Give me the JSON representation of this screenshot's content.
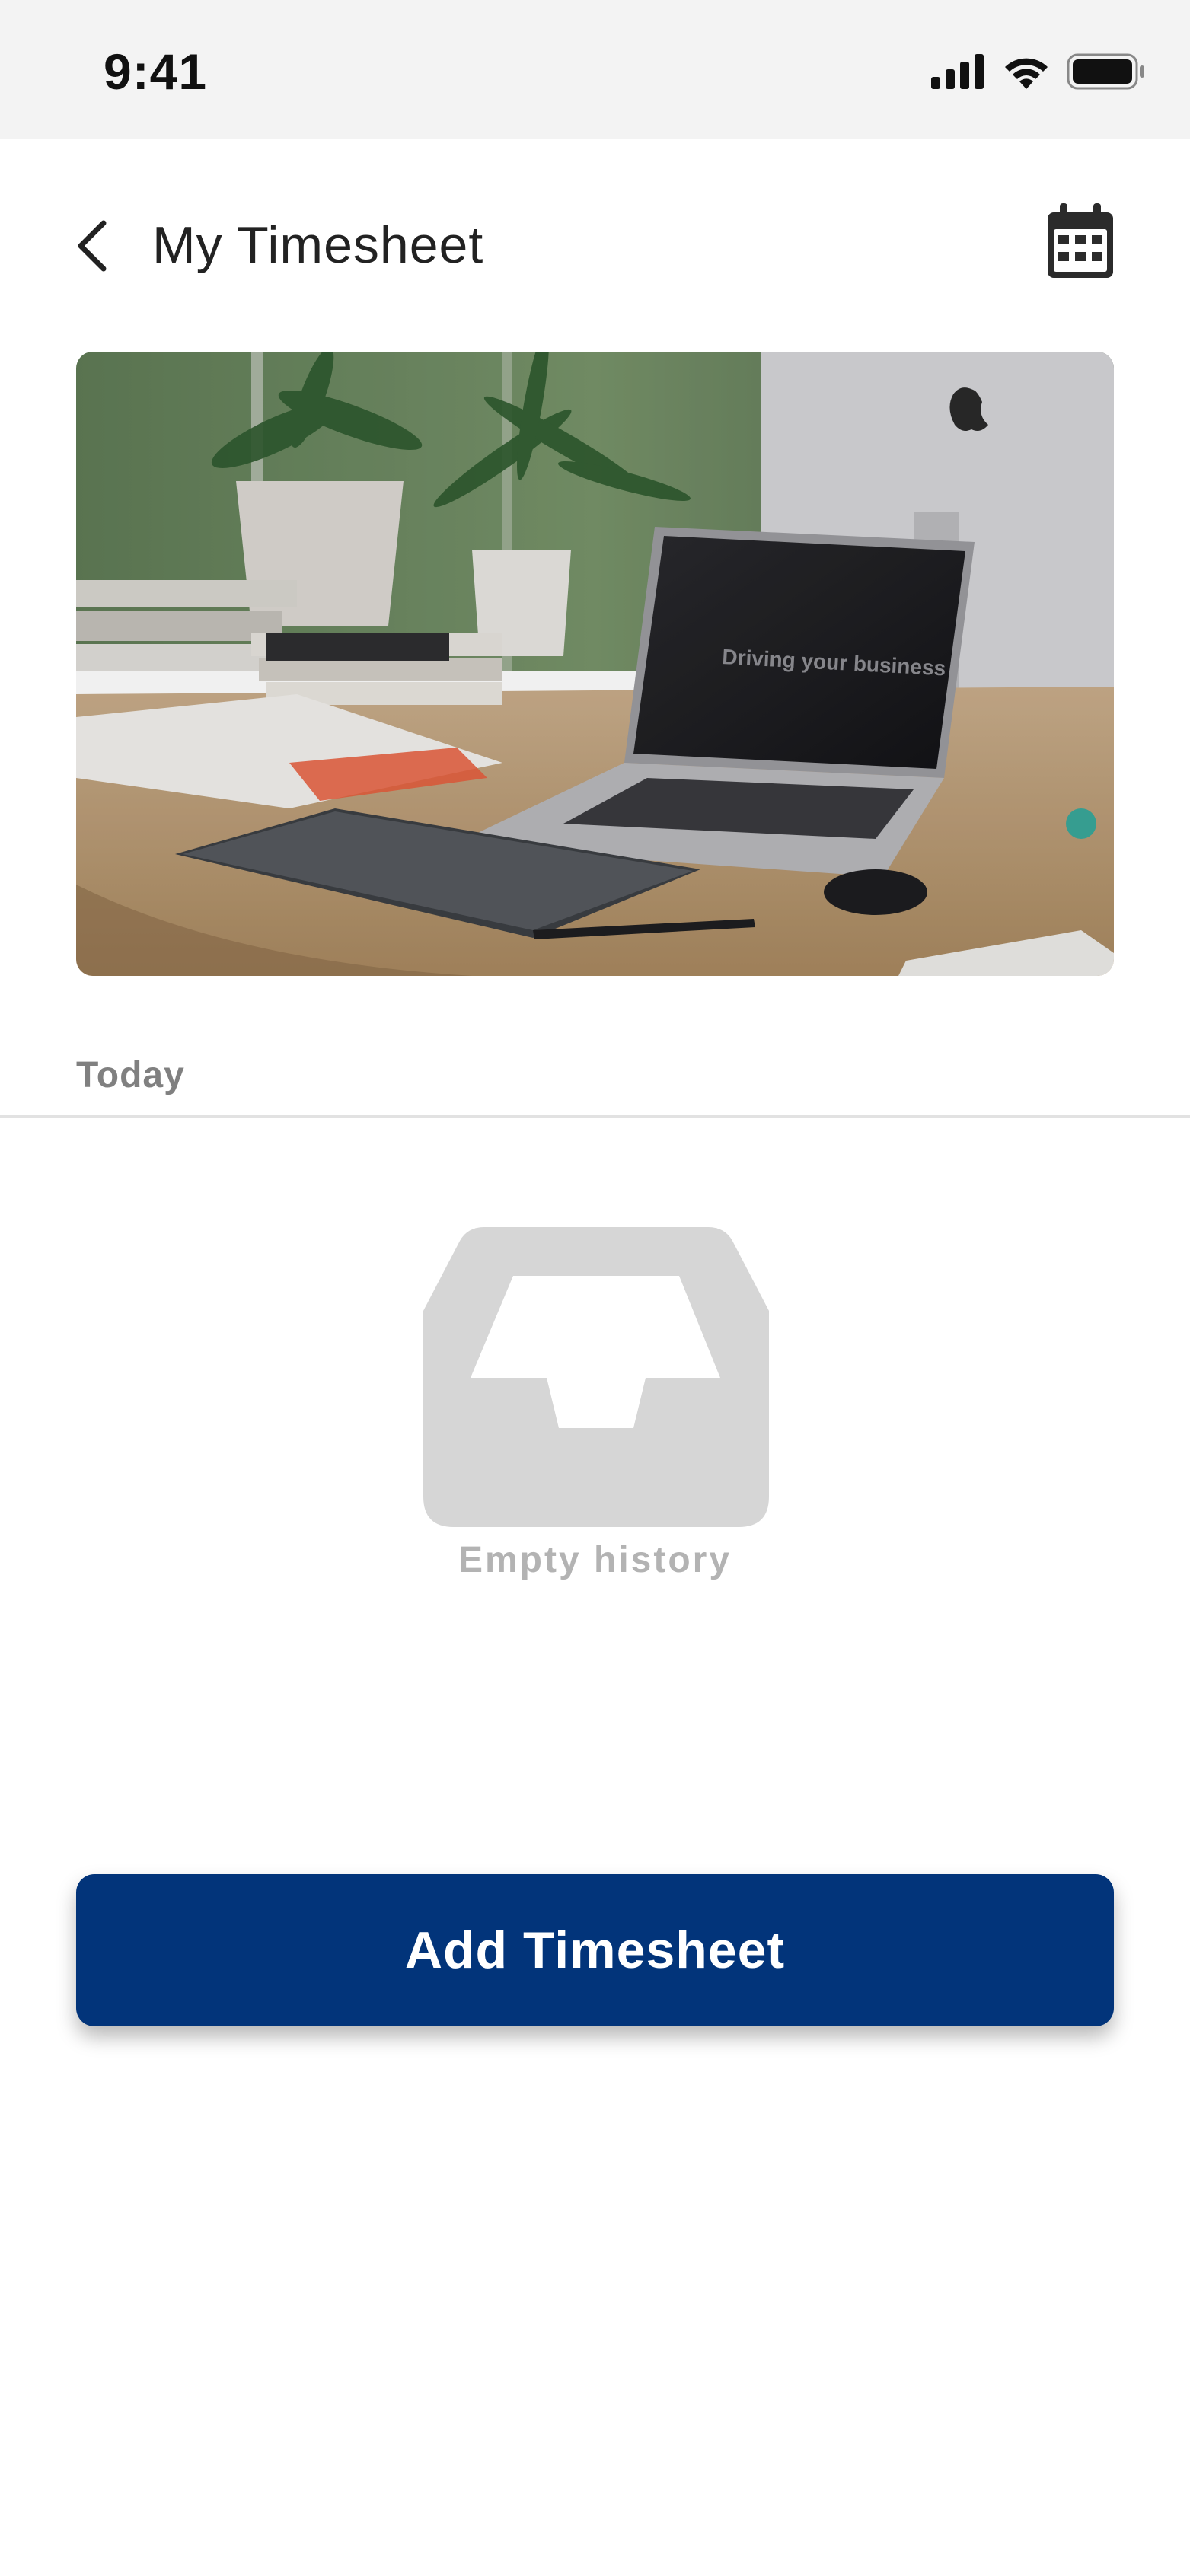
{
  "status_bar": {
    "time": "9:41",
    "icons": [
      "cellular-signal-icon",
      "wifi-icon",
      "battery-icon"
    ]
  },
  "header": {
    "title": "My Timesheet",
    "back_icon": "chevron-left-icon",
    "calendar_icon": "calendar-icon"
  },
  "hero_image": {
    "screen_text": "Driving your business"
  },
  "section": {
    "label": "Today"
  },
  "empty_state": {
    "icon": "empty-inbox-icon",
    "text": "Empty history"
  },
  "actions": {
    "add_label": "Add Timesheet"
  },
  "colors": {
    "primary": "#02347a",
    "status_bar_bg": "#f3f3f3",
    "muted_text": "#808080",
    "empty_gray": "#d6d6d6"
  }
}
